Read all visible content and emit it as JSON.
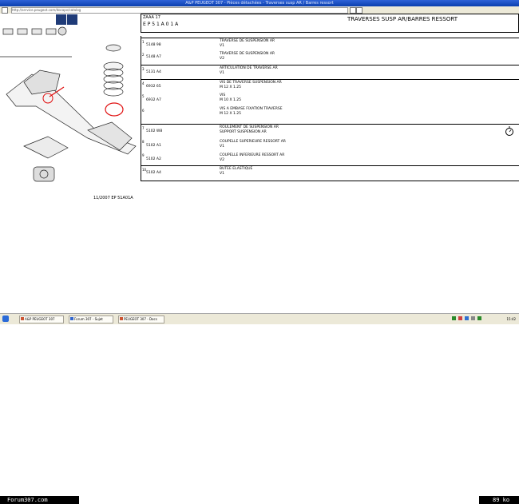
{
  "window": {
    "title": "A&P PEUGEOT 307 - Pièces détachées - Traverses susp AR / Barres ressort"
  },
  "toolbar": {
    "address": "http://service.peugeot.com/docapv/catalog"
  },
  "illustration": {
    "ref_code": "11/2007 EP 51A01A"
  },
  "header": {
    "code_top": "ZAAA 17",
    "code_bottom": "E P 5 1 A 0 1 A",
    "section_title": "TRAVERSES SUSP AR/BARRES RESSORT"
  },
  "parts": [
    {
      "index": "1",
      "part_no": "5148 98",
      "lines": [
        "TRAVERSE DE SUSPENSION AR",
        "V1"
      ]
    },
    {
      "index": "2",
      "part_no": "5148 A7",
      "lines": [
        "TRAVERSE DE SUSPENSION AR",
        "V2"
      ]
    },
    {
      "index": "3",
      "part_no": "5131 A4",
      "lines": [
        "ARTICULATION DE TRAVERSE AR",
        "V1"
      ]
    },
    {
      "index": "4",
      "part_no": "6932 65",
      "lines": [
        "VIS DE TRAVERSE SUSPENSION AR",
        "M 12 X 1.25"
      ]
    },
    {
      "index": "5",
      "part_no": "6932 A7",
      "lines": [
        "VIS",
        "M 10 X 1.25"
      ]
    },
    {
      "index": "6",
      "part_no": "",
      "lines": [
        "VIS A EMBASE FIXATION TRAVERSE",
        "M 12 X 1.25"
      ]
    },
    {
      "index": "7",
      "part_no": "5102 W8",
      "lines": [
        "ROULEMENT DE SUSPENSION AR",
        "SUPPORT SUSPENSION AR"
      ]
    },
    {
      "index": "8",
      "part_no": "5102 A1",
      "lines": [
        "COUPELLE SUPERIEURE RESSORT AR",
        "V1"
      ]
    },
    {
      "index": "9",
      "part_no": "5102 A2",
      "lines": [
        "COUPELLE INFERIEURE RESSORT AR",
        "V2"
      ]
    },
    {
      "index": "10",
      "part_no": "5102 A4",
      "lines": [
        "BUTEE ELASTIQUE",
        "V1"
      ]
    }
  ],
  "tabs": {
    "start_icon": "start-icon",
    "items": [
      "A&P PEUGEOT 307",
      "Forum 307 - Sujet",
      "PEUGEOT 307 - Docs"
    ]
  },
  "tray": {
    "clock": "15:42"
  },
  "footer": {
    "site": "Forum307.com",
    "size": "89 ko"
  },
  "colors": {
    "accent": "#1f3b78",
    "red_circle": "#e01010",
    "titlebar": "#0a3fae"
  }
}
